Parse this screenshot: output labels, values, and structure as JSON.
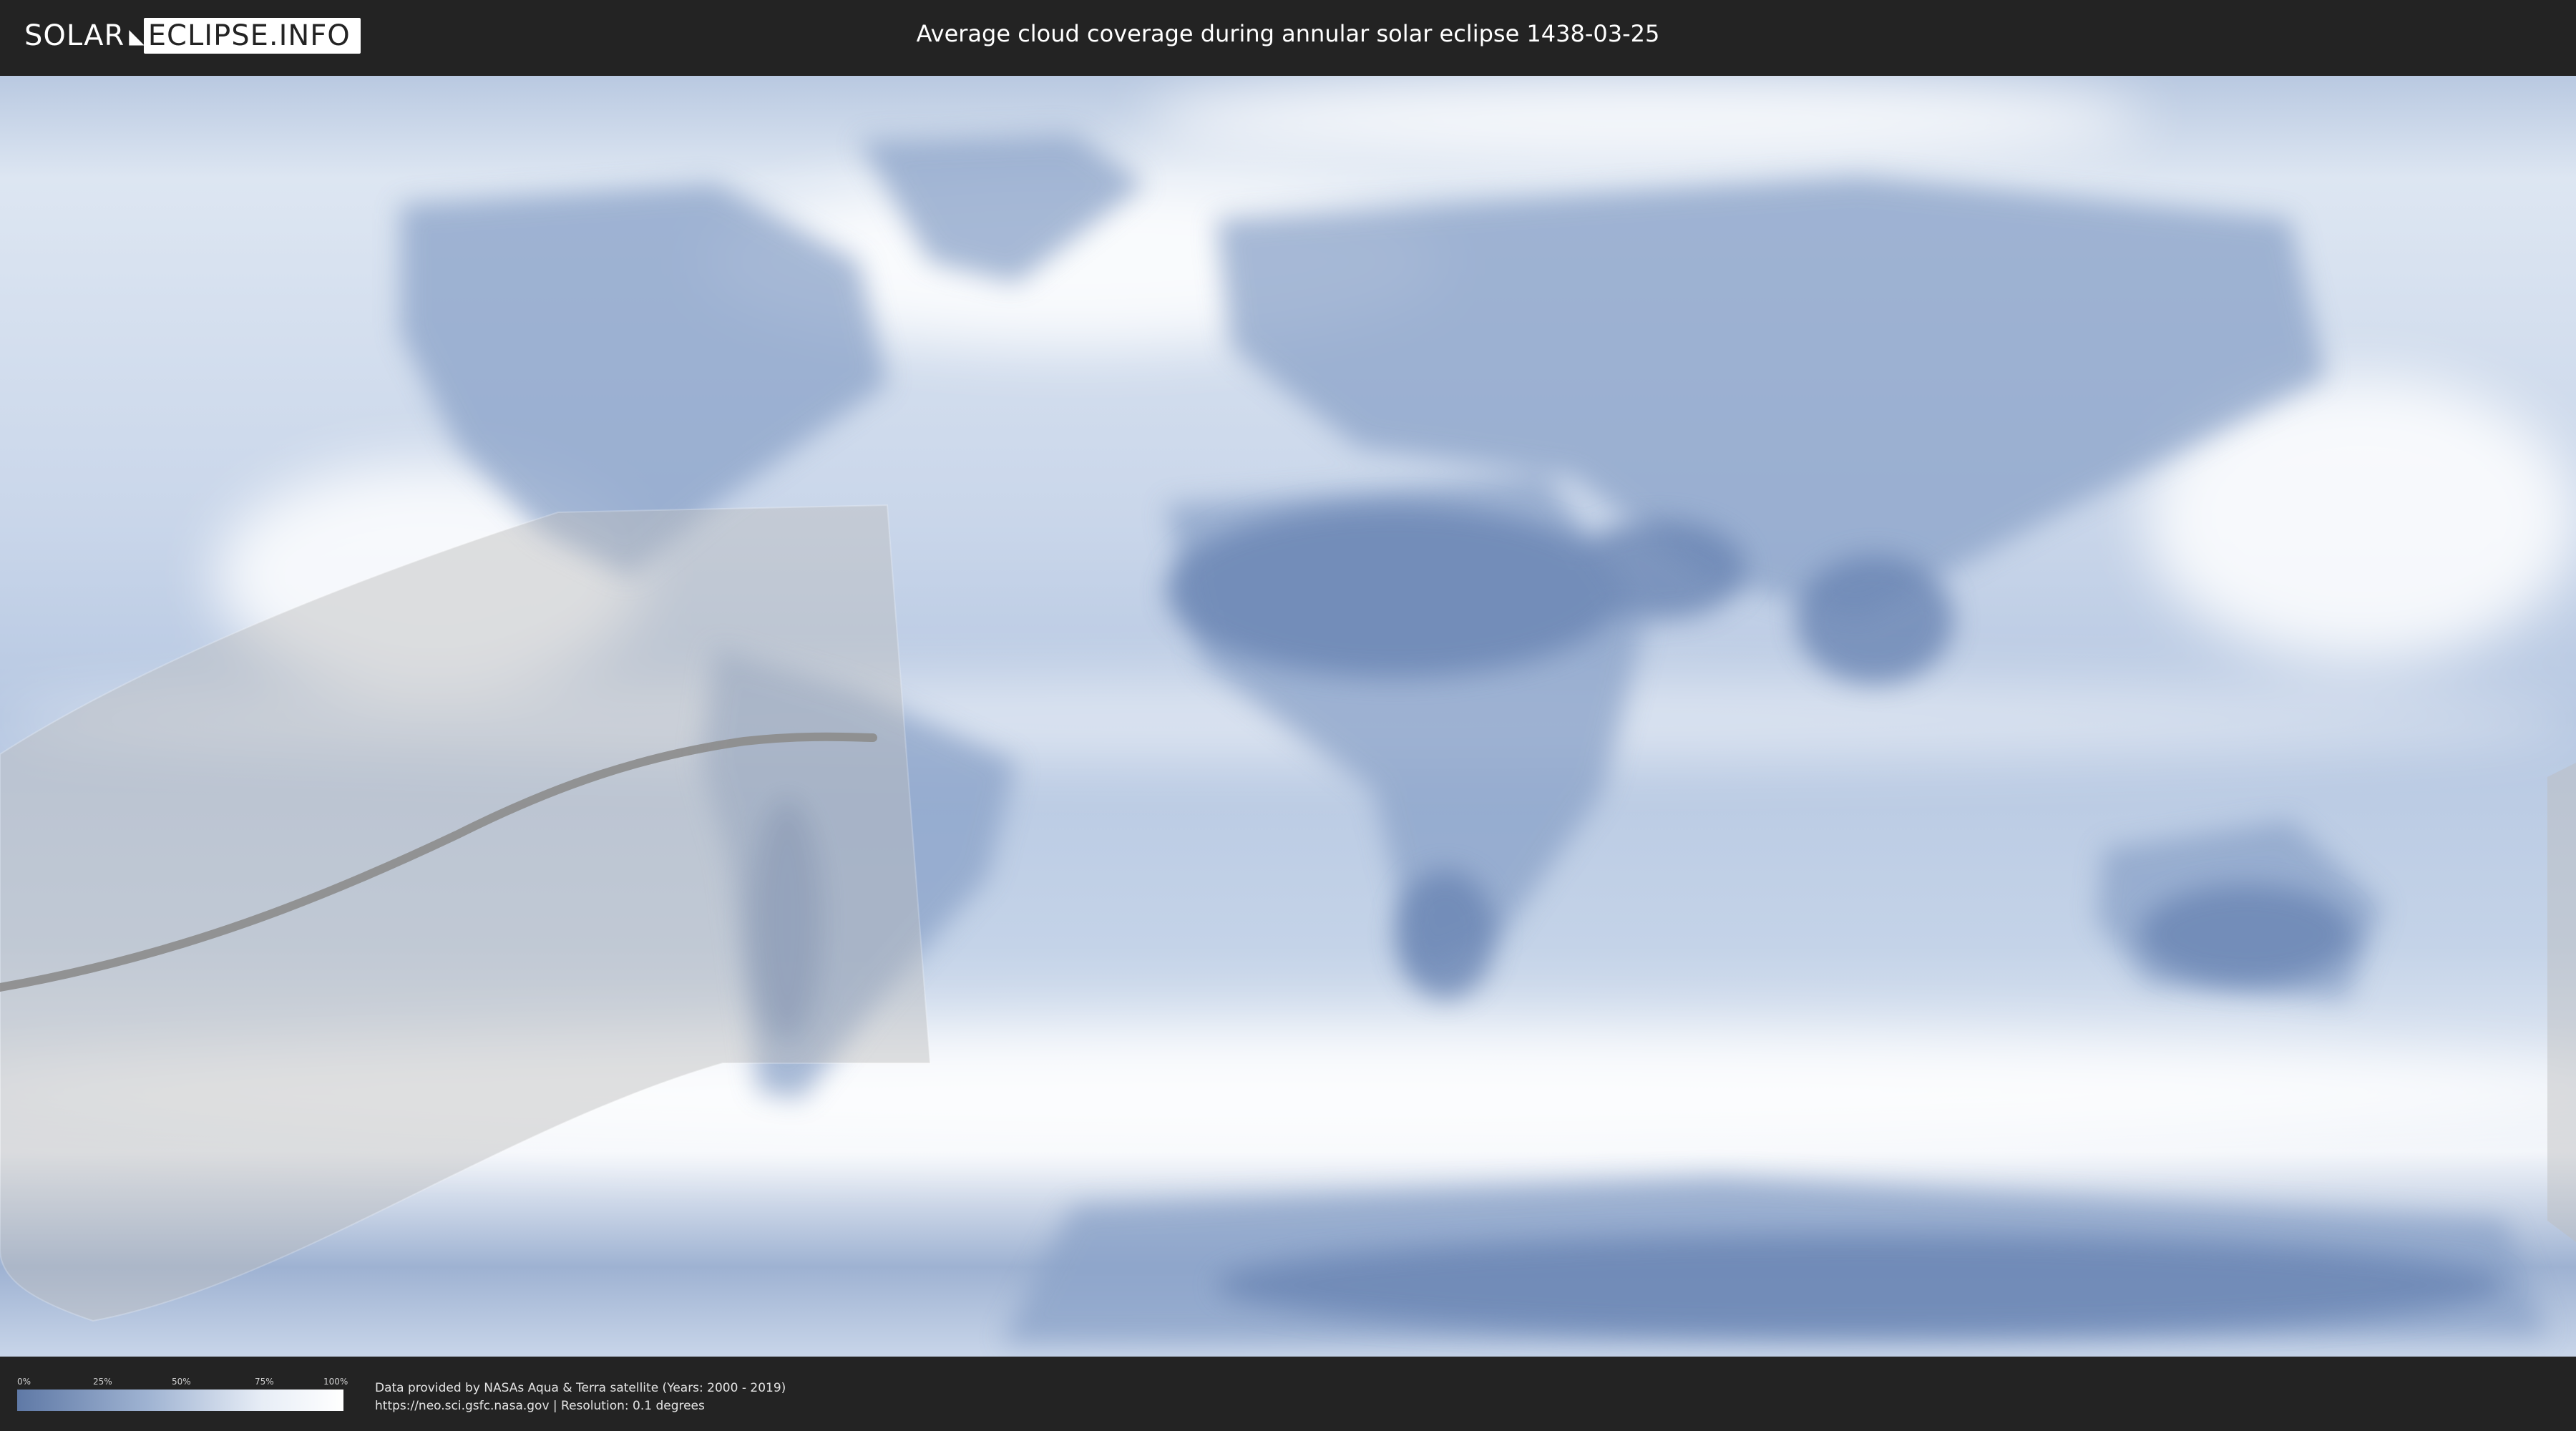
{
  "header": {
    "logo_left": "SOLAR",
    "logo_right": "ECLIPSE.INFO",
    "title": "Average cloud coverage during annular solar eclipse 1438-03-25"
  },
  "legend": {
    "labels": [
      "0%",
      "25%",
      "50%",
      "75%",
      "100%"
    ],
    "color_low": "#5f79a6",
    "color_high": "#ffffff"
  },
  "credits": {
    "line1": "Data provided by NASAs Aqua & Terra satellite (Years: 2000 - 2019)",
    "line2": "https://neo.sci.gsfc.nasa.gov | Resolution: 0.1 degrees"
  },
  "colors": {
    "background": "#232323",
    "cloud_clear": "#7d96bd",
    "cloud_full": "#ffffff",
    "eclipse_path": "#8c8c8c"
  }
}
